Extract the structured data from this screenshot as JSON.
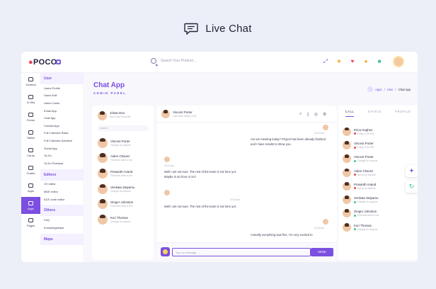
{
  "header": {
    "title": "Live Chat"
  },
  "topbar": {
    "logo": "POCO",
    "search_placeholder": "Search Your Product...",
    "icons": [
      "expand-icon",
      "star-icon",
      "heart-icon",
      "bell-icon",
      "puzzle-icon"
    ]
  },
  "sidenav": [
    {
      "label": "General"
    },
    {
      "label": "UI Kits"
    },
    {
      "label": "Forms"
    },
    {
      "label": "Tables"
    },
    {
      "label": "Cards"
    },
    {
      "label": "Charts"
    },
    {
      "label": "Apps",
      "active": true
    },
    {
      "label": "Pages"
    }
  ],
  "submenu": {
    "sections": [
      {
        "title": "User",
        "items": [
          "Users Profile",
          "Users Edit",
          "Users Cards",
          "Email App",
          "Chat App",
          "Contact App",
          "Full Calender Basic",
          "Full Calender Advance",
          "Social App",
          "To-Do",
          "To-Do Firebase"
        ]
      },
      {
        "title": "Editors",
        "items": [
          "CK editor",
          "MDE editor",
          "ACE code editor"
        ]
      },
      {
        "title": "Others",
        "items": [
          "FAQ",
          "Knowledgebase"
        ]
      },
      {
        "title": "Maps",
        "items": []
      }
    ]
  },
  "page": {
    "title": "Chat App",
    "subtitle": "ADMIN PANEL",
    "breadcrumb": "Apps / User / Chat App",
    "breadcrumb_parts": [
      "Apps",
      "User",
      "Chat App"
    ]
  },
  "me": {
    "name": "Johan Deo",
    "status": "Set to My Favourite"
  },
  "contacts_search": "search",
  "contacts": [
    {
      "name": "Vincent Porter",
      "status": "Change for anyone"
    },
    {
      "name": "Aiden Chavez",
      "status": "First best have a bot"
    },
    {
      "name": "Prasanth Anand",
      "status": "First best have a bot"
    },
    {
      "name": "Venkata Satyamu",
      "status": "Change for anyone"
    },
    {
      "name": "Ginger Johnston",
      "status": "First best have a bot"
    },
    {
      "name": "Kori Thomas",
      "status": "Change for anyone"
    }
  ],
  "chat": {
    "contact_name": "Vincent Porter",
    "last_seen": "Last seen today 15:24",
    "send_label": "SEND",
    "input_placeholder": "Type a message ......",
    "messages": [
      {
        "time": "10:12 am",
        "text": "Are we meeting today? Project has been already finished and I have results to show you.",
        "side": "right"
      },
      {
        "time": "10:14 am",
        "text": "Well I am not sure. The rest of the team is not here yet. Maybe in an hour or so?",
        "side": "left"
      },
      {
        "time": "10:16 am",
        "text": "Well I am not sure. The rest of the team is not here yet.",
        "side": "left"
      },
      {
        "time": "10:16 am",
        "text": "Actually everything was fine. I'm very excited to",
        "side": "right"
      }
    ]
  },
  "right_tabs": [
    "CALL",
    "STATUS",
    "PROFILE"
  ],
  "calls": [
    {
      "name": "Erica Hughes",
      "status": "5 May, 4:40 PM",
      "color": "#e8455a"
    },
    {
      "name": "Vincent Porter",
      "status": "5 May, 5:30 PM",
      "color": "#e8455a"
    },
    {
      "name": "Vincent Porter",
      "status": "Change for anyone",
      "color": "#41c48a"
    },
    {
      "name": "Aiden Chavez",
      "status": "Out is my favorite",
      "color": "#e8455a"
    },
    {
      "name": "Prasanth Anand",
      "status": "Out is my favorite",
      "color": "#e8455a"
    },
    {
      "name": "Venkata Satyamu",
      "status": "Change for anyone",
      "color": "#41c48a"
    },
    {
      "name": "Ginger Johnston",
      "status": "First best have a bot",
      "color": "#41c48a"
    },
    {
      "name": "Kori Thomas",
      "status": "Change for anyone",
      "color": "#41c48a"
    }
  ],
  "colors": {
    "accent": "#7b4fe0",
    "background": "#eceff7"
  }
}
